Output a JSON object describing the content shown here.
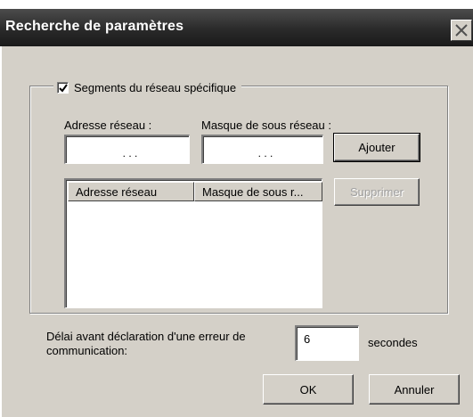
{
  "window": {
    "title": "Recherche de paramètres"
  },
  "group": {
    "checkbox_label": "Segments du réseau spécifique",
    "checked": true,
    "address_label": "Adresse réseau :",
    "mask_label": "Masque de sous réseau :",
    "address_value": ".       .       .",
    "mask_value": ".       .       .",
    "add_button": "Ajouter",
    "remove_button": "Supprimer",
    "list_columns": [
      "Adresse réseau",
      "Masque de sous r..."
    ]
  },
  "timeout": {
    "label": "Délai avant déclaration d'une erreur de communication:",
    "value": "6",
    "unit": "secondes"
  },
  "footer": {
    "ok_button": "OK",
    "cancel_button": "Annuler"
  }
}
